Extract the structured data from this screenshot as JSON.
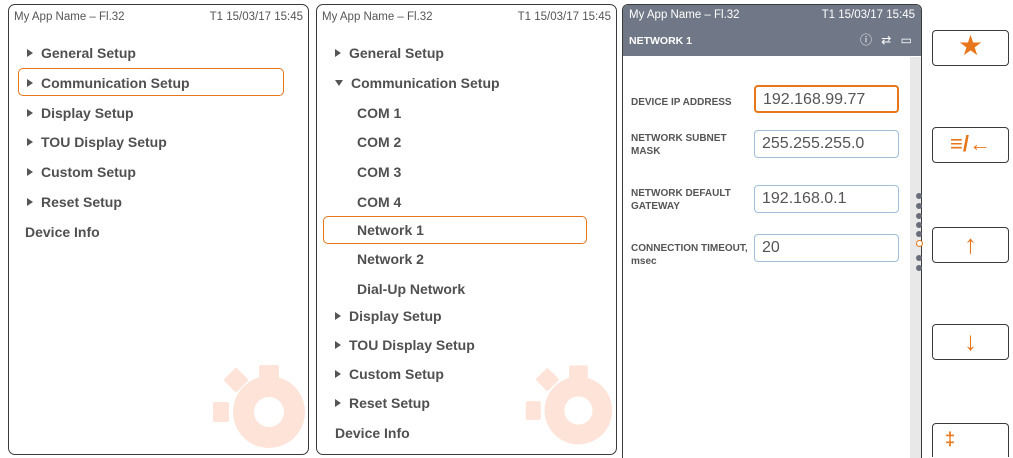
{
  "header": {
    "app_name": "My App Name – Fl.32",
    "time": "T1  15/03/17 15:45"
  },
  "panel1": {
    "items": [
      {
        "label": "General Setup"
      },
      {
        "label": "Communication Setup"
      },
      {
        "label": "Display Setup"
      },
      {
        "label": "TOU Display Setup"
      },
      {
        "label": "Custom Setup"
      },
      {
        "label": "Reset Setup"
      }
    ],
    "device_info": "Device Info"
  },
  "panel2": {
    "general": "General Setup",
    "communication": "Communication Setup",
    "subitems": [
      "COM 1",
      "COM 2",
      "COM 3",
      "COM 4",
      "Network 1",
      "Network 2",
      "Dial-Up Network"
    ],
    "display": "Display Setup",
    "tou": "TOU Display Setup",
    "custom": "Custom Setup",
    "reset": "Reset Setup",
    "device_info": "Device Info"
  },
  "panel3": {
    "title": "NETWORK 1",
    "status_icons": "ⓘ ⇄ ▭",
    "fields": [
      {
        "label": "DEVICE  IP ADDRESS",
        "value": "192.168.99.77"
      },
      {
        "label": "NETWORK SUBNET MASK",
        "value": "255.255.255.0"
      },
      {
        "label": "NETWORK DEFAULT GATEWAY",
        "value": "192.168.0.1"
      },
      {
        "label": "CONNECTION TIMEOUT, msec",
        "value": "20"
      }
    ]
  },
  "softkeys": {
    "star": "★",
    "menu_back": "≡/←",
    "up": "↑",
    "down": "↓",
    "bottom": "‡"
  },
  "colors": {
    "accent": "#e8761a",
    "title_bar": "#707887",
    "field_border": "#9fbfdd"
  }
}
